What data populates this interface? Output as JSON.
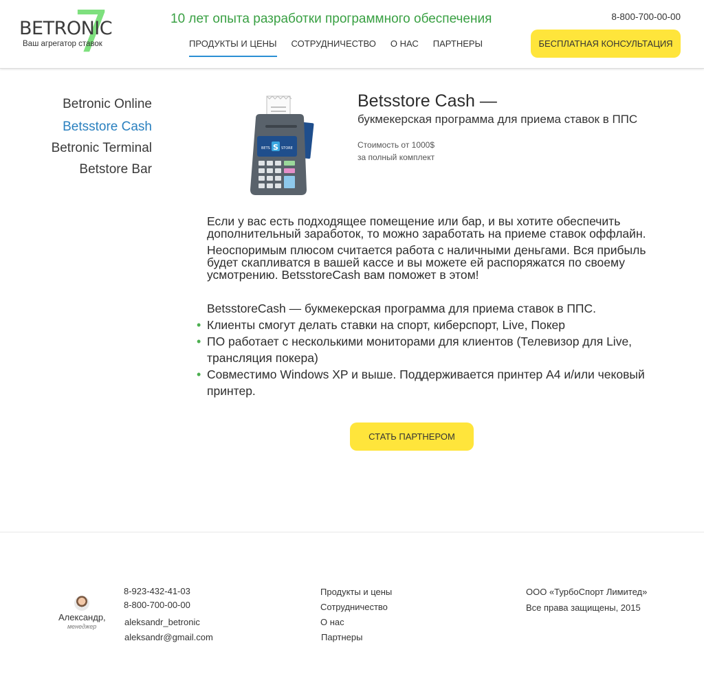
{
  "header": {
    "logo_word": "BETRONIC",
    "logo_digit": "7",
    "logo_tagline": "Ваш агрегатор ставок",
    "tagline": "10 лет опыта разработки программного обеспечения",
    "phone": "8-800-700-00-00",
    "consult_button": "БЕСПЛАТНАЯ КОНСУЛЬТАЦИЯ",
    "nav": [
      {
        "label": "ПРОДУКТЫ И ЦЕНЫ",
        "active": true
      },
      {
        "label": "СОТРУДНИЧЕСТВО",
        "active": false
      },
      {
        "label": "О НАС",
        "active": false
      },
      {
        "label": "ПАРТНЕРЫ",
        "active": false
      }
    ],
    "accent_color": "#2a8fd4",
    "tagline_color": "#39a043",
    "button_color": "#ffe53b"
  },
  "sidebar": {
    "items": [
      {
        "label": "Betronic Online",
        "active": false
      },
      {
        "label": "Betsstore Cash",
        "active": true
      },
      {
        "label": "Betronic Terminal",
        "active": false
      },
      {
        "label": "Betstore Bar",
        "active": false
      }
    ]
  },
  "product": {
    "image_icon": "pos-terminal-icon",
    "screen_text": "BETS STORE",
    "title": "Betsstore Cash —",
    "subtitle": "букмекерская программа для приема ставок в ППС",
    "price_line1": "Стоимость от 1000$",
    "price_line2": "за полный комплект",
    "paragraph1": "Если у вас есть подходящее помещение или бар, и вы хотите обеспечить дополнительный заработок, то можно заработать на приеме ставок оффлайн.",
    "paragraph2": "Неоспоримым плюсом считается работа с наличными деньгами. Вся прибыль будет скапливатся в вашей кассе и вы можете ей распоряжатся по своему усмотрению. BetsstoreCash вам поможет в этом!",
    "list_intro": "BetsstoreCash — букмекерская программа для приема ставок в ППС.",
    "features": [
      "Клиенты смогут делать ставки на спорт, киберспорт, Live, Покер",
      "ПО работает с несколькими мониторами для клиентов (Телевизор для Live, трансляция покера)",
      "Совместимо Windows XP и выше. Поддерживается принтер А4 и/или чековый принтер."
    ],
    "partner_button": "СТАТЬ ПАРТНЕРОМ"
  },
  "footer": {
    "manager_name": "Александр,",
    "manager_role": "менеджер",
    "phone1": "8-923-432-41-03",
    "phone2": "8-800-700-00-00",
    "skype": "aleksandr_betronic",
    "email": "aleksandr@gmail.com",
    "links": [
      "Продукты и цены",
      "Сотрудничество",
      "О нас",
      "Партнеры"
    ],
    "company": "ООО «ТурбоСпорт Лимитед»",
    "rights": "Все права защищены, 2015"
  }
}
